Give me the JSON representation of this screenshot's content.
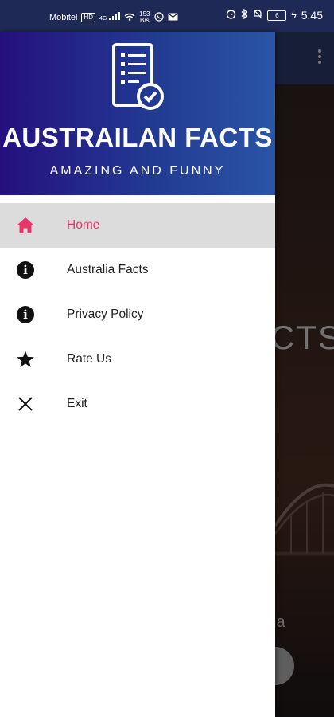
{
  "status_bar": {
    "carrier": "Mobitel",
    "network_badge": "HD",
    "signal": "4G",
    "speed_value": "153",
    "speed_unit": "B/s",
    "battery": "6",
    "time": "5:45"
  },
  "background_screen": {
    "title_fragment": "CTS",
    "subtitle_fragment": "ia"
  },
  "drawer": {
    "app_title": "AUSTRAILAN FACTS",
    "app_subtitle": "AMAZING AND FUNNY",
    "items": [
      {
        "label": "Home",
        "icon": "home-icon",
        "active": true
      },
      {
        "label": "Australia Facts",
        "icon": "info-icon",
        "active": false
      },
      {
        "label": "Privacy Policy",
        "icon": "info-icon",
        "active": false
      },
      {
        "label": "Rate Us",
        "icon": "star-icon",
        "active": false
      },
      {
        "label": "Exit",
        "icon": "close-icon",
        "active": false
      }
    ]
  },
  "colors": {
    "accent": "#e8376a",
    "header_start": "#25107e",
    "header_end": "#2a55a6",
    "active_bg": "#dcdcdc"
  }
}
